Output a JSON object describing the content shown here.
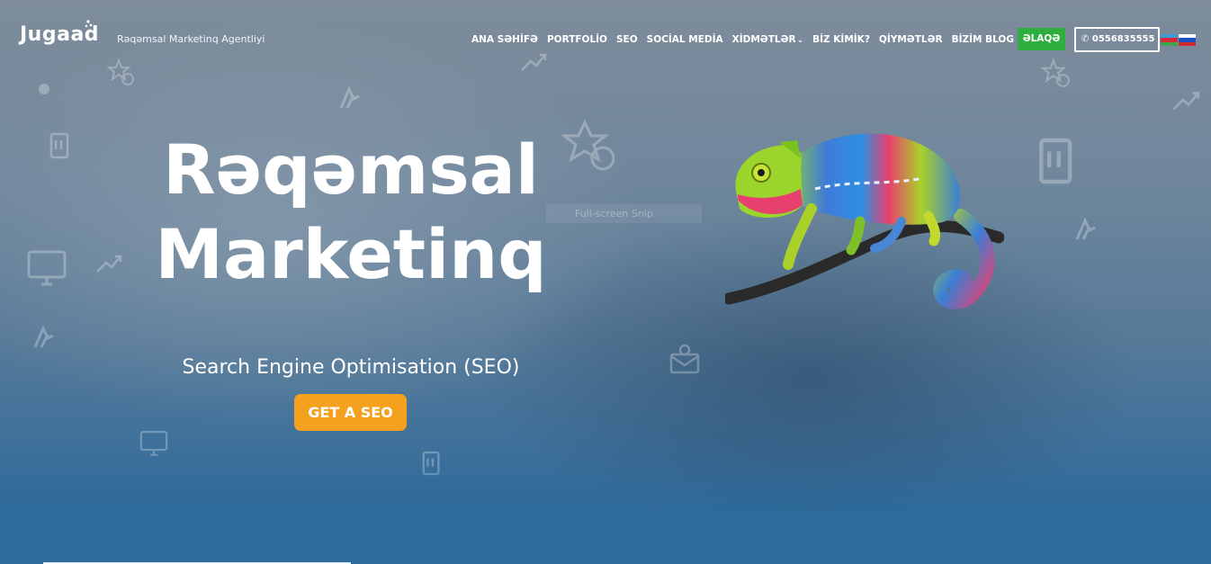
{
  "brand": {
    "logo_text": "Jugaad",
    "tagline": "Rəqəmsal Marketinq Agentliyi"
  },
  "nav": {
    "items": [
      {
        "label": "ANA SƏHİFƏ"
      },
      {
        "label": "PORTFOLİO"
      },
      {
        "label": "SEO"
      },
      {
        "label": "SOCİAL MEDİA"
      },
      {
        "label": "XİDMƏTLƏR"
      },
      {
        "label": "BİZ KİMİK?"
      },
      {
        "label": "QİYMƏTLƏR"
      },
      {
        "label": "BİZİM BLOG"
      }
    ],
    "dropdown_icon": "chevron-down-icon",
    "contact_label": "ƏLAQƏ",
    "phone_icon": "phone-icon",
    "phone_label": "0556835555",
    "languages": [
      "az-flag-icon",
      "ru-flag-icon"
    ]
  },
  "hero": {
    "title_line1": "Rəqəmsal",
    "title_line2": "Marketinq",
    "subtitle": "Search Engine Optimisation (SEO)",
    "cta_label": "GET A SEO",
    "overlay_label": "Full-screen Snip",
    "image": "chameleon-illustration"
  },
  "colors": {
    "contact_green": "#2eae3f",
    "cta_orange": "#f4a11f",
    "background_blue": "#2f6a98"
  }
}
